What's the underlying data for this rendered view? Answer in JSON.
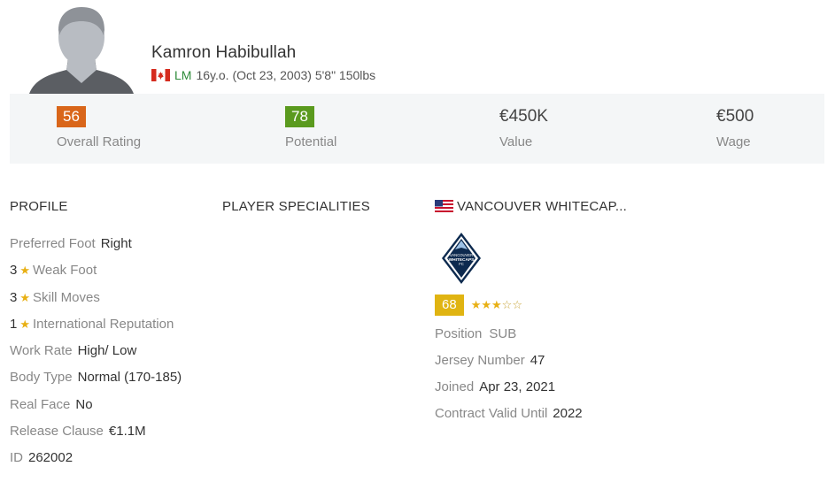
{
  "player": {
    "name": "Kamron Habibullah",
    "position": "LM",
    "details": "16y.o. (Oct 23, 2003) 5'8\" 150lbs",
    "nationality_flag": "canada-flag-icon"
  },
  "stats": [
    {
      "value": "56",
      "label": "Overall Rating",
      "color": "#d9661a"
    },
    {
      "value": "78",
      "label": "Potential",
      "color": "#5a9a1e"
    },
    {
      "value": "€450K",
      "label": "Value"
    },
    {
      "value": "€500",
      "label": "Wage"
    }
  ],
  "sections": {
    "profile": "PROFILE",
    "specialities": "PLAYER SPECIALITIES",
    "club": "VANCOUVER WHITECAP..."
  },
  "profile": {
    "preferred_foot": {
      "label": "Preferred Foot",
      "value": "Right"
    },
    "weak_foot": {
      "num": "3",
      "label": "Weak Foot"
    },
    "skill_moves": {
      "num": "3",
      "label": "Skill Moves"
    },
    "intl_rep": {
      "num": "1",
      "label": "International Reputation"
    },
    "work_rate": {
      "label": "Work Rate",
      "value": "High/ Low"
    },
    "body_type": {
      "label": "Body Type",
      "value": "Normal (170-185)"
    },
    "real_face": {
      "label": "Real Face",
      "value": "No"
    },
    "release_clause": {
      "label": "Release Clause",
      "value": "€1.1M"
    },
    "id": {
      "label": "ID",
      "value": "262002"
    }
  },
  "club": {
    "rating": "68",
    "stars_filled": 3,
    "stars_total": 5,
    "logo_text": [
      "VANCOUVER",
      "WHITECAPS",
      "FC"
    ],
    "position": {
      "label": "Position",
      "value": "SUB"
    },
    "jersey": {
      "label": "Jersey Number",
      "value": "47"
    },
    "joined": {
      "label": "Joined",
      "value": "Apr 23, 2021"
    },
    "contract": {
      "label": "Contract Valid Until",
      "value": "2022"
    }
  }
}
